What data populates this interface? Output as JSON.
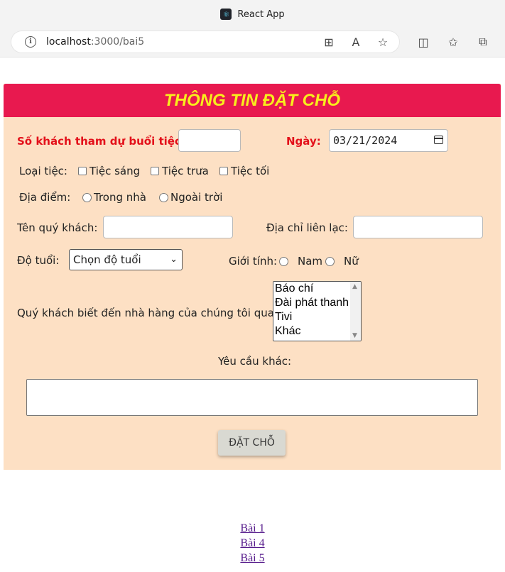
{
  "browser": {
    "tab_title": "React App",
    "url_host": "localhost",
    "url_path": ":3000/bai5"
  },
  "form": {
    "title": "THÔNG TIN ĐẶT CHỖ",
    "guest_count_label": "Số khách tham dự buổi tiệc:",
    "guest_count_value": "",
    "date_label": "Ngày:",
    "date_value": "03/21/2024",
    "party_type_label": "Loại tiệc:",
    "party_types": [
      "Tiệc sáng",
      "Tiệc trưa",
      "Tiệc tối"
    ],
    "location_label": "Địa điểm:",
    "locations": [
      "Trong nhà",
      "Ngoài trời"
    ],
    "guest_name_label": "Tên quý khách:",
    "guest_name_value": "",
    "address_label": "Địa chỉ liên lạc:",
    "address_value": "",
    "age_label": "Độ tuổi:",
    "age_selected": "Chọn độ tuổi",
    "gender_label": "Giới tính:",
    "genders": [
      "Nam",
      "Nữ"
    ],
    "source_label": "Quý khách biết đến nhà hàng của chúng tôi qua:",
    "source_options": [
      "Báo chí",
      "Đài phát thanh",
      "Tivi",
      "Khác"
    ],
    "other_requests_label": "Yêu cầu khác:",
    "other_requests_value": "",
    "submit_label": "ĐẶT CHỖ"
  },
  "links": [
    "Bài 1",
    "Bài 4",
    "Bài 5"
  ],
  "colors": {
    "header_bg": "#e8194f",
    "header_text": "#f8ee1c",
    "form_bg": "#fde0c4",
    "required_label": "#e3101a",
    "link": "#551a8b"
  }
}
